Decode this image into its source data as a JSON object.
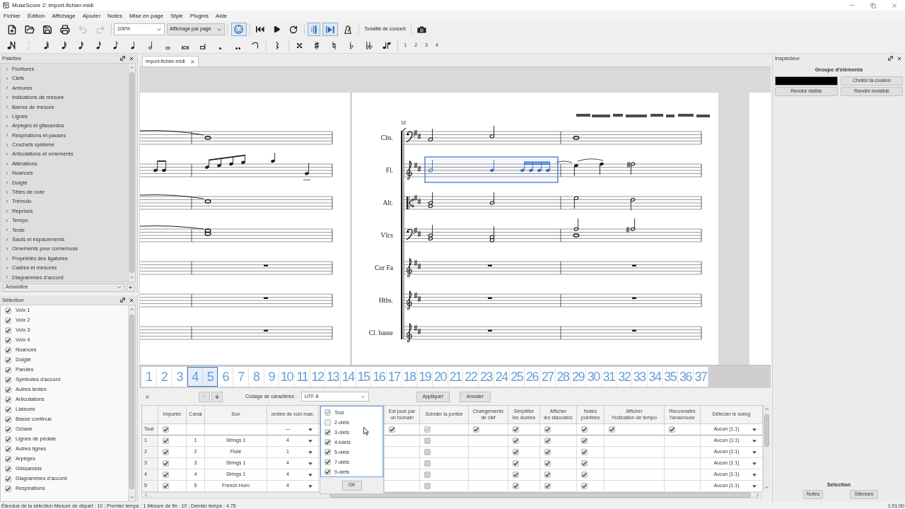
{
  "window": {
    "title": "MuseScore 2: import-fichier-midi"
  },
  "menu": [
    "Fichier",
    "Édition",
    "Affichage",
    "Ajouter",
    "Notes",
    "Mise en page",
    "Style",
    "Plugins",
    "Aide"
  ],
  "toolbar": {
    "undo": {
      "disabled": true
    },
    "redo": {
      "disabled": true
    },
    "zoom": "100%",
    "view_mode": "Affichage par page",
    "midi_input": {
      "on": true
    },
    "play_repeats": {
      "on": true
    },
    "pan_score": {
      "on": true
    },
    "concert_pitch": {
      "label": "Tonalité de concert",
      "on": false
    }
  },
  "note_toolbar": {
    "voices": [
      "1",
      "2",
      "3",
      "4"
    ]
  },
  "palettes": {
    "title": "Palettes",
    "items": [
      {
        "label": "Fioritures",
        "expanded": false
      },
      {
        "label": "Clefs",
        "expanded": false
      },
      {
        "label": "Armures",
        "expanded": false
      },
      {
        "label": "Indications de mesure",
        "expanded": false
      },
      {
        "label": "Barres de mesure",
        "expanded": false
      },
      {
        "label": "Lignes",
        "expanded": false
      },
      {
        "label": "Arpèges et glissandos",
        "expanded": false
      },
      {
        "label": "Respirations et pauses",
        "expanded": false
      },
      {
        "label": "Crochets système",
        "expanded": false
      },
      {
        "label": "Articulations et ornements",
        "expanded": false
      },
      {
        "label": "Altérations",
        "expanded": false
      },
      {
        "label": "Nuances",
        "expanded": false
      },
      {
        "label": "Doigté",
        "expanded": false
      },
      {
        "label": "Têtes de note",
        "expanded": false
      },
      {
        "label": "Trémolo",
        "expanded": false
      },
      {
        "label": "Reprises",
        "expanded": false
      },
      {
        "label": "Tempo",
        "expanded": false
      },
      {
        "label": "Texte",
        "expanded": false
      },
      {
        "label": "Sauts et espacements",
        "expanded": false
      },
      {
        "label": "Ornements pour cornemuse",
        "expanded": false
      },
      {
        "label": "Propriétés des ligatures",
        "expanded": false
      },
      {
        "label": "Cadres et mesures",
        "expanded": false
      },
      {
        "label": "Diagrammes d'accord",
        "expanded": false
      }
    ],
    "workspace": "Amandine"
  },
  "selection_filter": {
    "title": "Sélection",
    "items": [
      {
        "label": "Voix 1",
        "checked": true
      },
      {
        "label": "Voix 2",
        "checked": true
      },
      {
        "label": "Voix 3",
        "checked": true
      },
      {
        "label": "Voix 4",
        "checked": true
      },
      {
        "label": "Nuances",
        "checked": true
      },
      {
        "label": "Doigté",
        "checked": true
      },
      {
        "label": "Paroles",
        "checked": true
      },
      {
        "label": "Symboles d'accord",
        "checked": true
      },
      {
        "label": "Autres textes",
        "checked": true
      },
      {
        "label": "Articulations",
        "checked": true
      },
      {
        "label": "Liaisons",
        "checked": true
      },
      {
        "label": "Basse continue",
        "checked": true
      },
      {
        "label": "Octave",
        "checked": true
      },
      {
        "label": "Lignes de pédale",
        "checked": true
      },
      {
        "label": "Autres lignes",
        "checked": true
      },
      {
        "label": "Arpèges",
        "checked": true
      },
      {
        "label": "Glissandos",
        "checked": true
      },
      {
        "label": "Diagrammes d'accord",
        "checked": true
      },
      {
        "label": "Respirations",
        "checked": true
      }
    ]
  },
  "score_tab": {
    "label": "import-fichier-midi",
    "selected": true
  },
  "score": {
    "measure_number": "10",
    "staves": [
      {
        "name": "Cbs.",
        "kind": "bass"
      },
      {
        "name": "Fl.",
        "kind": "treble"
      },
      {
        "name": "Alt.",
        "kind": "alto"
      },
      {
        "name": "Vlcs",
        "kind": "bass"
      },
      {
        "name": "Cor Fa",
        "kind": "treble"
      },
      {
        "name": "Htbs.",
        "kind": "treble"
      },
      {
        "name": "Cl. basse",
        "kind": "treble"
      }
    ]
  },
  "navigator": {
    "pages": [
      "1",
      "2",
      "3",
      "4",
      "5",
      "6",
      "7",
      "8",
      "9",
      "10",
      "11",
      "12",
      "13",
      "14",
      "15",
      "16",
      "17",
      "18",
      "19",
      "20",
      "21",
      "22",
      "23",
      "24",
      "25",
      "26",
      "27",
      "28",
      "29",
      "30",
      "31",
      "32",
      "33",
      "34",
      "35",
      "36",
      "37"
    ]
  },
  "midi_import": {
    "move_up": {
      "disabled": true
    },
    "move_down": {
      "disabled": false
    },
    "encoding_label": "Codage de caractères :",
    "encoding": "UTF-8",
    "buttons": [
      "Appliquer",
      "Annuler"
    ],
    "columns": [
      "Importer",
      "Canal",
      "Son",
      "ombre de voix max.",
      "Est joué par\nun humain",
      "Scinder la portée",
      "Changements\nde clef",
      "Simplifier\nles durées",
      "Afficher\nles staccatos",
      "Notes\npointées",
      "Afficher\nl'indication de tempo",
      "Reconnaitre\nl'anacrouse",
      "Détecter le swing"
    ],
    "rows": [
      {
        "label": "Tout",
        "cells": [
          {
            "kind": "check",
            "checked": true,
            "disabled": false
          },
          null,
          null,
          {
            "kind": "combo",
            "value": "—"
          },
          {
            "kind": "check",
            "checked": true,
            "disabled": false
          },
          {
            "kind": "check",
            "checked": true,
            "disabled": true
          },
          {
            "kind": "check",
            "checked": true,
            "disabled": false
          },
          {
            "kind": "check",
            "checked": true,
            "disabled": false
          },
          {
            "kind": "check",
            "checked": true,
            "disabled": false
          },
          {
            "kind": "check",
            "checked": true,
            "disabled": false
          },
          {
            "kind": "check",
            "checked": true,
            "disabled": false
          },
          {
            "kind": "check",
            "checked": true,
            "disabled": false
          },
          {
            "kind": "combo",
            "value": "Aucun (1:1)"
          }
        ]
      },
      {
        "label": "1",
        "cells": [
          {
            "kind": "check",
            "checked": true,
            "disabled": false
          },
          {
            "kind": "text",
            "value": "1"
          },
          {
            "kind": "text",
            "value": "Strings 1"
          },
          {
            "kind": "combo",
            "value": "4"
          },
          null,
          {
            "kind": "check",
            "checked": false,
            "disabled": true
          },
          null,
          {
            "kind": "check",
            "checked": true,
            "disabled": false
          },
          {
            "kind": "check",
            "checked": true,
            "disabled": false
          },
          {
            "kind": "check",
            "checked": true,
            "disabled": false
          },
          null,
          null,
          {
            "kind": "combo",
            "value": "Aucun (1:1)"
          }
        ]
      },
      {
        "label": "2",
        "cells": [
          {
            "kind": "check",
            "checked": true,
            "disabled": false
          },
          {
            "kind": "text",
            "value": "2"
          },
          {
            "kind": "text",
            "value": "Flute"
          },
          {
            "kind": "combo",
            "value": "1"
          },
          null,
          {
            "kind": "check",
            "checked": false,
            "disabled": true
          },
          null,
          {
            "kind": "check",
            "checked": true,
            "disabled": false
          },
          {
            "kind": "check",
            "checked": true,
            "disabled": false
          },
          {
            "kind": "check",
            "checked": true,
            "disabled": false
          },
          null,
          null,
          {
            "kind": "combo",
            "value": "Aucun (1:1)"
          }
        ]
      },
      {
        "label": "3",
        "cells": [
          {
            "kind": "check",
            "checked": true,
            "disabled": false
          },
          {
            "kind": "text",
            "value": "3"
          },
          {
            "kind": "text",
            "value": "Strings 1"
          },
          {
            "kind": "combo",
            "value": "4"
          },
          null,
          {
            "kind": "check",
            "checked": false,
            "disabled": true
          },
          null,
          {
            "kind": "check",
            "checked": true,
            "disabled": false
          },
          {
            "kind": "check",
            "checked": true,
            "disabled": false
          },
          {
            "kind": "check",
            "checked": true,
            "disabled": false
          },
          null,
          null,
          {
            "kind": "combo",
            "value": "Aucun (1:1)"
          }
        ]
      },
      {
        "label": "4",
        "cells": [
          {
            "kind": "check",
            "checked": true,
            "disabled": false
          },
          {
            "kind": "text",
            "value": "4"
          },
          {
            "kind": "text",
            "value": "Strings 1"
          },
          {
            "kind": "combo",
            "value": "4"
          },
          null,
          {
            "kind": "check",
            "checked": false,
            "disabled": true
          },
          null,
          {
            "kind": "check",
            "checked": true,
            "disabled": false
          },
          {
            "kind": "check",
            "checked": true,
            "disabled": false
          },
          {
            "kind": "check",
            "checked": true,
            "disabled": false
          },
          null,
          null,
          {
            "kind": "combo",
            "value": "Aucun (1:1)"
          }
        ]
      },
      {
        "label": "5",
        "cells": [
          {
            "kind": "check",
            "checked": true,
            "disabled": false
          },
          {
            "kind": "text",
            "value": "5"
          },
          {
            "kind": "text",
            "value": "French Horn"
          },
          {
            "kind": "combo",
            "value": "4"
          },
          null,
          {
            "kind": "check",
            "checked": false,
            "disabled": true
          },
          null,
          {
            "kind": "check",
            "checked": true,
            "disabled": false
          },
          {
            "kind": "check",
            "checked": true,
            "disabled": false
          },
          {
            "kind": "check",
            "checked": true,
            "disabled": false
          },
          null,
          null,
          {
            "kind": "combo",
            "value": "Aucun (1:1)"
          }
        ]
      }
    ],
    "tuplets_menu": {
      "items": [
        {
          "label": "Tout",
          "checked": true,
          "disabled": true
        },
        {
          "label": "2-olets",
          "checked": false,
          "disabled": false
        },
        {
          "label": "3-olets",
          "checked": true,
          "disabled": false
        },
        {
          "label": "4-tolets",
          "checked": true,
          "disabled": false
        },
        {
          "label": "5-olets",
          "checked": true,
          "disabled": false
        },
        {
          "label": "7-olets",
          "checked": true,
          "disabled": false
        },
        {
          "label": "9-olets",
          "checked": true,
          "disabled": false
        }
      ],
      "ok": "OK"
    }
  },
  "inspector": {
    "title": "Inspecteur",
    "group_title": "Groupe d'éléments",
    "color": "#000000",
    "buttons": [
      "Choisir la couleur",
      "Rendre visible",
      "Rendre invisible"
    ],
    "selection_title": "Sélection",
    "selection_buttons": [
      "Notes",
      "Silences"
    ]
  },
  "status_bar": {
    "message": "Étendue de la sélection Mesure de départ : 10 ; Premier temps : 1 Mesure de fin : 10 ; Dernier temps : 4.75",
    "position": "1:01:00"
  }
}
